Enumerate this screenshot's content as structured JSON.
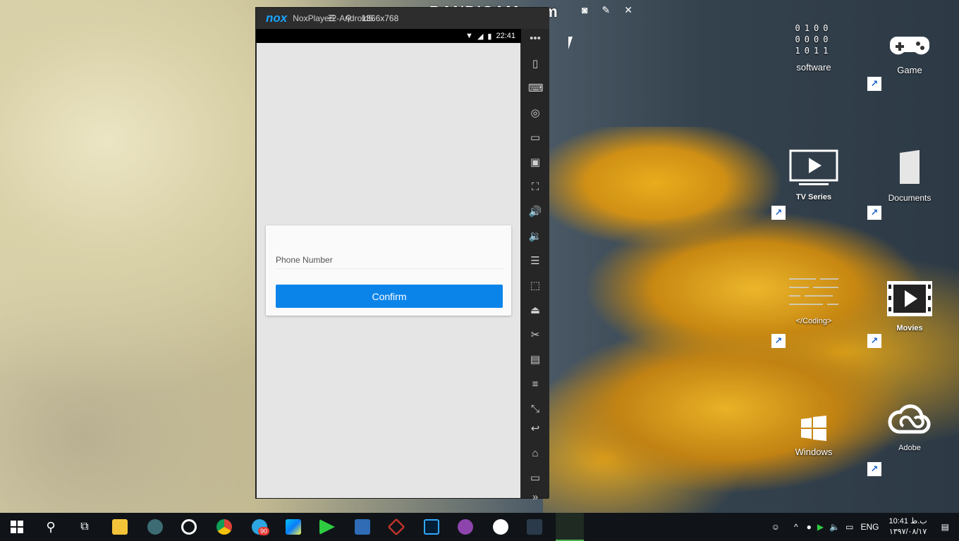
{
  "recorder": {
    "watermark": "www.BANDICAM.com",
    "resolution": "1366x768"
  },
  "emulator": {
    "logo": "nox",
    "title": "NoxPlayer2-Android5.",
    "status_time": "22:41"
  },
  "app": {
    "phone_placeholder": "Phone Number",
    "confirm_label": "Confirm",
    "accent_color": "#0b84ea"
  },
  "toolbar_icons": [
    "more-icon",
    "shake-icon",
    "keyboard-icon",
    "location-icon",
    "screen-icon",
    "apk-icon",
    "fullscreen-icon",
    "volume-up-icon",
    "volume-down-icon",
    "toolbox-icon",
    "macro-icon",
    "record-icon",
    "scissors-icon",
    "multi-instance-icon",
    "menu-icon",
    "resize-icon",
    "back-icon",
    "home-icon",
    "recent-apps-icon",
    "expand-icon"
  ],
  "desktop": {
    "icons": [
      {
        "label": "software"
      },
      {
        "label": "Game"
      },
      {
        "label": "TV Series"
      },
      {
        "label": "Documents"
      },
      {
        "label": "</Coding>"
      },
      {
        "label": "Movies"
      },
      {
        "label": "Windows"
      },
      {
        "label": "Adobe"
      }
    ]
  },
  "taskbar": {
    "language": "ENG",
    "time": "10:41 ب.ظ",
    "date": "۱۳۹۷/۰۸/۱۷",
    "badge_count": "90"
  }
}
